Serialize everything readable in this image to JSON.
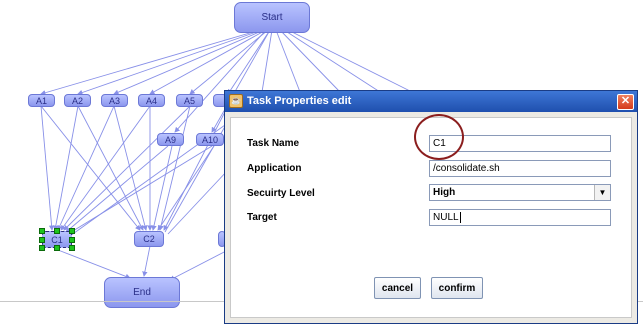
{
  "graph": {
    "start": "Start",
    "end": "End",
    "top_row": [
      "A1",
      "A2",
      "A3",
      "A4",
      "A5"
    ],
    "second_row": [
      "A9",
      "A10"
    ],
    "bottom_row": [
      "C1",
      "C2"
    ]
  },
  "dialog": {
    "title": "Task Properties edit",
    "fields": {
      "task_name_label": "Task Name",
      "task_name_value": "C1",
      "application_label": "Application",
      "application_value": "/consolidate.sh",
      "security_label": "Secuirty Level",
      "security_value": "High",
      "target_label": "Target",
      "target_value": "NULL"
    },
    "buttons": {
      "cancel": "cancel",
      "confirm": "confirm"
    }
  },
  "colors": {
    "node_fill": "#9aa5f5",
    "edge": "#8890e8",
    "title_bar": "#2c5fc4",
    "annotation_circle": "#8b1e1e"
  }
}
